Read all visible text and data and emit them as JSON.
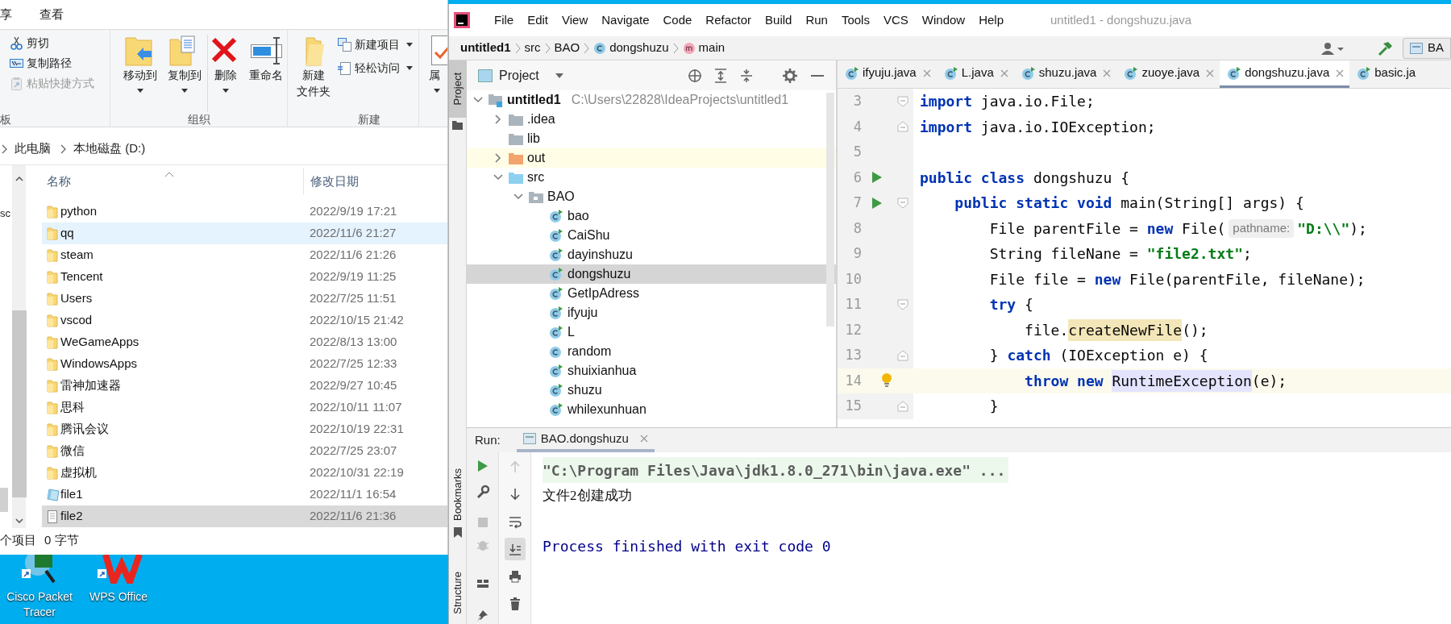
{
  "explorer": {
    "ribbon_tabs": [
      {
        "label": "享"
      },
      {
        "label": "查看"
      }
    ],
    "clipboard": {
      "label": "板",
      "items": [
        {
          "label": "剪切",
          "disabled": false
        },
        {
          "label": "复制路径",
          "disabled": false
        },
        {
          "label": "粘贴快捷方式",
          "disabled": true
        }
      ]
    },
    "organize": {
      "label": "组织",
      "items": [
        {
          "label": "移动到",
          "dropdown": true
        },
        {
          "label": "复制到",
          "dropdown": true
        },
        {
          "label": "删除",
          "dropdown": true
        },
        {
          "label": "重命名",
          "dropdown": false
        }
      ]
    },
    "new": {
      "label": "新建",
      "folder_button": [
        "新建",
        "文件夹"
      ],
      "items": [
        {
          "label": "新建项目",
          "dropdown": true
        },
        {
          "label": "轻松访问",
          "dropdown": true
        }
      ]
    },
    "open": {
      "label": "属",
      "dropdown": true
    },
    "address": [
      "此电脑",
      "本地磁盘 (D:)"
    ],
    "nav_text": "sc",
    "columns": [
      "名称",
      "修改日期"
    ],
    "files": [
      {
        "name": "python",
        "modified": "2022/9/19 17:21",
        "kind": "folder",
        "selected": false,
        "hovered": false
      },
      {
        "name": "qq",
        "modified": "2022/11/6 21:27",
        "kind": "folder",
        "selected": false,
        "hovered": true
      },
      {
        "name": "steam",
        "modified": "2022/11/6 21:26",
        "kind": "folder",
        "selected": false,
        "hovered": false
      },
      {
        "name": "Tencent",
        "modified": "2022/9/19 11:25",
        "kind": "folder",
        "selected": false,
        "hovered": false
      },
      {
        "name": "Users",
        "modified": "2022/7/25 11:51",
        "kind": "folder",
        "selected": false,
        "hovered": false
      },
      {
        "name": "vscod",
        "modified": "2022/10/15 21:42",
        "kind": "folder",
        "selected": false,
        "hovered": false
      },
      {
        "name": "WeGameApps",
        "modified": "2022/8/13 13:00",
        "kind": "folder",
        "selected": false,
        "hovered": false
      },
      {
        "name": "WindowsApps",
        "modified": "2022/7/25 12:33",
        "kind": "folder",
        "selected": false,
        "hovered": false
      },
      {
        "name": "雷神加速器",
        "modified": "2022/9/27 10:45",
        "kind": "folder",
        "selected": false,
        "hovered": false
      },
      {
        "name": "思科",
        "modified": "2022/10/11 11:07",
        "kind": "folder",
        "selected": false,
        "hovered": false
      },
      {
        "name": "腾讯会议",
        "modified": "2022/10/19 22:31",
        "kind": "folder",
        "selected": false,
        "hovered": false
      },
      {
        "name": "微信",
        "modified": "2022/7/25 23:07",
        "kind": "folder",
        "selected": false,
        "hovered": false
      },
      {
        "name": "虚拟机",
        "modified": "2022/10/31 22:19",
        "kind": "folder",
        "selected": false,
        "hovered": false
      },
      {
        "name": "file1",
        "modified": "2022/11/1 16:54",
        "kind": "document",
        "selected": false,
        "hovered": false
      },
      {
        "name": "file2",
        "modified": "2022/11/6 21:36",
        "kind": "text",
        "selected": true,
        "hovered": false
      }
    ],
    "status": [
      "个项目",
      "0 字节"
    ]
  },
  "desktop_icons": [
    {
      "label": "Cisco Packet\nTracer"
    },
    {
      "label": "WPS Office"
    }
  ],
  "ide": {
    "menu": [
      "File",
      "Edit",
      "View",
      "Navigate",
      "Code",
      "Refactor",
      "Build",
      "Run",
      "Tools",
      "VCS",
      "Window",
      "Help"
    ],
    "title": "untitled1 - dongshuzu.java",
    "breadcrumbs": [
      {
        "label": "untitled1",
        "kind": "project"
      },
      {
        "label": "src",
        "kind": "folder"
      },
      {
        "label": "BAO",
        "kind": "folder"
      },
      {
        "label": "dongshuzu",
        "kind": "class"
      },
      {
        "label": "main",
        "kind": "method"
      }
    ],
    "run_config": "BA",
    "side_tabs": [
      {
        "label": "Project",
        "selected": true
      }
    ],
    "bottom_side_tabs": [
      {
        "label": "Bookmarks"
      },
      {
        "label": "Structure"
      }
    ],
    "project_title": "Project",
    "tree": [
      {
        "label": "untitled1",
        "path": "C:\\Users\\22828\\IdeaProjects\\untitled1",
        "kind": "module",
        "expanded": true,
        "selected": false,
        "children": [
          {
            "label": ".idea",
            "kind": "folder",
            "expanded": false,
            "selected": false
          },
          {
            "label": "lib",
            "kind": "folder",
            "selected": false
          },
          {
            "label": "out",
            "kind": "excluded",
            "expanded": false,
            "selected": false,
            "highlighted": true
          },
          {
            "label": "src",
            "kind": "source",
            "expanded": true,
            "selected": false,
            "children": [
              {
                "label": "BAO",
                "kind": "package",
                "expanded": true,
                "selected": false,
                "children": [
                  {
                    "label": "bao",
                    "kind": "main-class",
                    "selected": false
                  },
                  {
                    "label": "CaiShu",
                    "kind": "main-class",
                    "selected": false
                  },
                  {
                    "label": "dayinshuzu",
                    "kind": "main-class",
                    "selected": false
                  },
                  {
                    "label": "dongshuzu",
                    "kind": "main-class",
                    "selected": true
                  },
                  {
                    "label": "GetIpAdress",
                    "kind": "main-class",
                    "selected": false
                  },
                  {
                    "label": "ifyuju",
                    "kind": "main-class",
                    "selected": false
                  },
                  {
                    "label": "L",
                    "kind": "main-class",
                    "selected": false
                  },
                  {
                    "label": "random",
                    "kind": "class",
                    "selected": false
                  },
                  {
                    "label": "shuixianhua",
                    "kind": "main-class",
                    "selected": false
                  },
                  {
                    "label": "shuzu",
                    "kind": "main-class",
                    "selected": false
                  },
                  {
                    "label": "whilexunhuan",
                    "kind": "main-class",
                    "selected": false
                  }
                ]
              }
            ]
          }
        ]
      }
    ],
    "editor_tabs": [
      {
        "label": "ifyuju.java",
        "selected": false,
        "closable": true
      },
      {
        "label": "L.java",
        "selected": false,
        "closable": true
      },
      {
        "label": "shuzu.java",
        "selected": false,
        "closable": true
      },
      {
        "label": "zuoye.java",
        "selected": false,
        "closable": true
      },
      {
        "label": "dongshuzu.java",
        "selected": true,
        "closable": true
      },
      {
        "label": "basic.ja",
        "selected": false,
        "closable": false
      }
    ],
    "lines": [
      {
        "number": "3",
        "run": false,
        "current": false,
        "bulb": false,
        "fold_start": true,
        "fold_end": false,
        "segments": [
          {
            "text": "import",
            "kind": "keyword"
          },
          {
            "text": " java.io.File;",
            "kind": "plain"
          }
        ]
      },
      {
        "number": "4",
        "run": false,
        "current": false,
        "bulb": false,
        "fold_start": false,
        "fold_end": true,
        "segments": [
          {
            "text": "import",
            "kind": "keyword"
          },
          {
            "text": " java.io.IOException;",
            "kind": "plain"
          }
        ]
      },
      {
        "number": "5",
        "run": false,
        "current": false,
        "bulb": false,
        "fold_start": false,
        "fold_end": false
      },
      {
        "number": "6",
        "run": true,
        "current": false,
        "bulb": false,
        "fold_start": false,
        "fold_end": false,
        "segments": [
          {
            "text": "public class",
            "kind": "keyword"
          },
          {
            "text": " dongshuzu {",
            "kind": "plain"
          }
        ]
      },
      {
        "number": "7",
        "run": true,
        "current": false,
        "bulb": false,
        "fold_start": true,
        "fold_end": false,
        "segments": [
          {
            "text": "    public static void",
            "kind": "keyword"
          },
          {
            "text": " main(String[] args) {",
            "kind": "plain"
          }
        ]
      },
      {
        "number": "8",
        "run": false,
        "current": false,
        "bulb": false,
        "fold_start": false,
        "fold_end": false,
        "segments": [
          {
            "text": "        File parentFile = ",
            "kind": "plain"
          },
          {
            "text": "new",
            "kind": "keyword"
          },
          {
            "text": " File(",
            "kind": "plain"
          },
          {
            "text": "pathname:",
            "kind": "hint"
          },
          {
            "text": "\"D:\\\\\"",
            "kind": "string"
          },
          {
            "text": ");",
            "kind": "plain"
          }
        ]
      },
      {
        "number": "9",
        "run": false,
        "current": false,
        "bulb": false,
        "fold_start": false,
        "fold_end": false,
        "segments": [
          {
            "text": "        String fileNane = ",
            "kind": "plain"
          },
          {
            "text": "\"file2.txt\"",
            "kind": "string"
          },
          {
            "text": ";",
            "kind": "plain"
          }
        ]
      },
      {
        "number": "10",
        "run": false,
        "current": false,
        "bulb": false,
        "fold_start": false,
        "fold_end": false,
        "segments": [
          {
            "text": "        File file = ",
            "kind": "plain"
          },
          {
            "text": "new",
            "kind": "keyword"
          },
          {
            "text": " File(parentFile, fileNane);",
            "kind": "plain"
          }
        ]
      },
      {
        "number": "11",
        "run": false,
        "current": false,
        "bulb": false,
        "fold_start": true,
        "fold_end": false,
        "segments": [
          {
            "text": "        try",
            "kind": "keyword"
          },
          {
            "text": " {",
            "kind": "plain"
          }
        ]
      },
      {
        "number": "12",
        "run": false,
        "current": false,
        "bulb": false,
        "fold_start": false,
        "fold_end": false,
        "segments": [
          {
            "text": "            file.",
            "kind": "plain"
          },
          {
            "text": "createNewFile",
            "kind": "usage"
          },
          {
            "text": "();",
            "kind": "plain"
          }
        ]
      },
      {
        "number": "13",
        "run": false,
        "current": false,
        "bulb": false,
        "fold_start": false,
        "fold_end": true,
        "segments": [
          {
            "text": "        } ",
            "kind": "plain"
          },
          {
            "text": "catch",
            "kind": "keyword"
          },
          {
            "text": " (IOException e) {",
            "kind": "plain"
          }
        ]
      },
      {
        "number": "14",
        "run": false,
        "current": true,
        "bulb": true,
        "fold_start": false,
        "fold_end": false,
        "segments": [
          {
            "text": "            throw new ",
            "kind": "keyword"
          },
          {
            "text": "RuntimeException",
            "kind": "reference"
          },
          {
            "text": "(e);",
            "kind": "plain"
          }
        ]
      },
      {
        "number": "15",
        "run": false,
        "current": false,
        "bulb": false,
        "fold_start": false,
        "fold_end": true,
        "segments": [
          {
            "text": "        }",
            "kind": "plain"
          }
        ]
      }
    ],
    "run_label": "Run:",
    "run_tab": "BAO.dongshuzu",
    "toolbar_left": [
      {
        "disabled": false
      },
      {
        "disabled": false
      },
      {
        "disabled": true
      },
      {
        "disabled": true
      },
      {
        "disabled": false
      },
      {
        "disabled": false
      }
    ],
    "toolbar_right": [
      {
        "disabled": true,
        "selected": false
      },
      {
        "disabled": false,
        "selected": false
      },
      {
        "disabled": false,
        "selected": false
      },
      {
        "disabled": false,
        "selected": true
      },
      {
        "disabled": false,
        "selected": false
      },
      {
        "disabled": false,
        "selected": false
      }
    ],
    "output": [
      {
        "text": "\"C:\\Program Files\\Java\\jdk1.8.0_271\\bin\\java.exe\" ...",
        "kind": "command"
      },
      {
        "text": "文件2创建成功",
        "kind": "stdout"
      },
      {
        "text": "Process finished with exit code 0",
        "kind": "exit"
      }
    ]
  }
}
